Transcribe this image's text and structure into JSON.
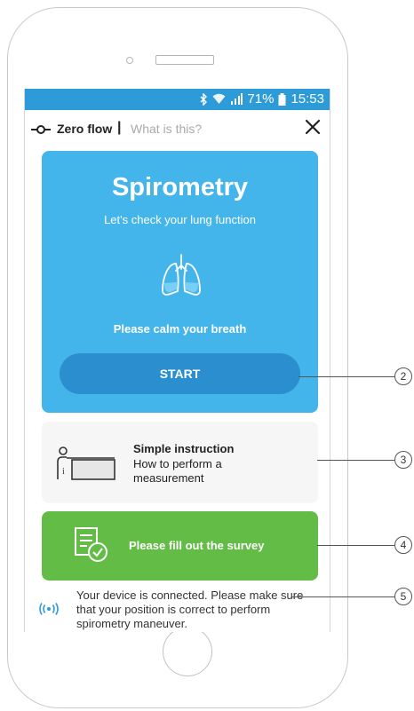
{
  "status_bar": {
    "battery_percent": "71%",
    "time": "15:53",
    "icons": [
      "bluetooth-icon",
      "wifi-icon",
      "signal-icon",
      "battery-icon"
    ]
  },
  "header": {
    "title": "Zero flow",
    "separator": "|",
    "help_link": "What is this?",
    "close_icon": "close-icon"
  },
  "spirometry": {
    "title": "Spirometry",
    "subtitle": "Let's check your lung function",
    "icon": "lungs-icon",
    "instruction": "Please calm your breath",
    "start_label": "START"
  },
  "instruction_card": {
    "title": "Simple instruction",
    "text": "How to perform a measurement",
    "icon": "presentation-icon"
  },
  "survey": {
    "label": "Please fill out the survey",
    "icon": "survey-check-icon"
  },
  "connection": {
    "text": "Your device is connected. Please make sure that your position is correct to perform spirometry maneuver.",
    "icon": "connected-signal-icon"
  },
  "callouts": [
    "2",
    "3",
    "4",
    "5"
  ],
  "colors": {
    "status_bar": "#2d9bd8",
    "spirometry_card": "#43b5eb",
    "start_button": "#2b8fcf",
    "survey_card": "#63bc46",
    "instruction_card": "#f6f6f6"
  }
}
